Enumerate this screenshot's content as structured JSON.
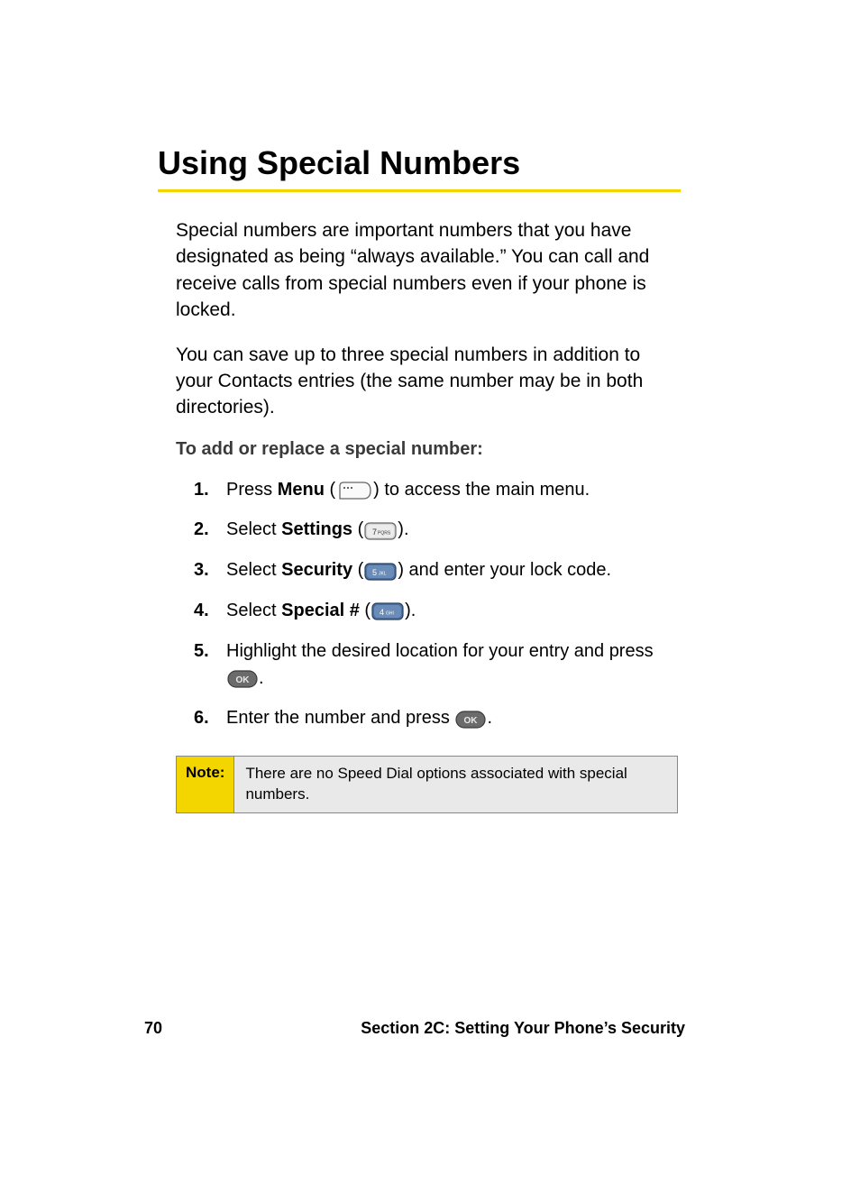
{
  "heading": "Using Special Numbers",
  "paragraphs": {
    "p1": "Special numbers are important numbers that you have designated as being “always available.” You can call and receive calls from special numbers even if your phone is locked.",
    "p2": "You can save up to three special numbers in addition to your Contacts entries (the same number may be in both directories)."
  },
  "subheading": "To add or replace a special number:",
  "steps": {
    "s1": {
      "num": "1.",
      "pre": "Press ",
      "bold": "Menu",
      "paren_open": " (",
      "paren_close": ") to access the main menu."
    },
    "s2": {
      "num": "2.",
      "pre": "Select ",
      "bold": "Settings",
      "paren_open": " (",
      "paren_close": ")."
    },
    "s3": {
      "num": "3.",
      "pre": "Select ",
      "bold": "Security",
      "paren_open": " (",
      "paren_close": ") and enter your lock code."
    },
    "s4": {
      "num": "4.",
      "pre": "Select ",
      "bold": "Special #",
      "paren_open": " (",
      "paren_close": ")."
    },
    "s5": {
      "num": "5.",
      "text_a": "Highlight the desired location for your entry and press ",
      "text_b": "."
    },
    "s6": {
      "num": "6.",
      "text_a": "Enter the number and press ",
      "text_b": "."
    }
  },
  "note": {
    "label": "Note:",
    "text": "There are no Speed Dial options associated with special numbers."
  },
  "footer": {
    "page": "70",
    "section": "Section 2C: Setting Your Phone’s Security"
  },
  "keys": {
    "menu": "MENU",
    "seven": "7PQRS",
    "five": "5JKL",
    "four": "4GHI",
    "ok": "OK"
  }
}
